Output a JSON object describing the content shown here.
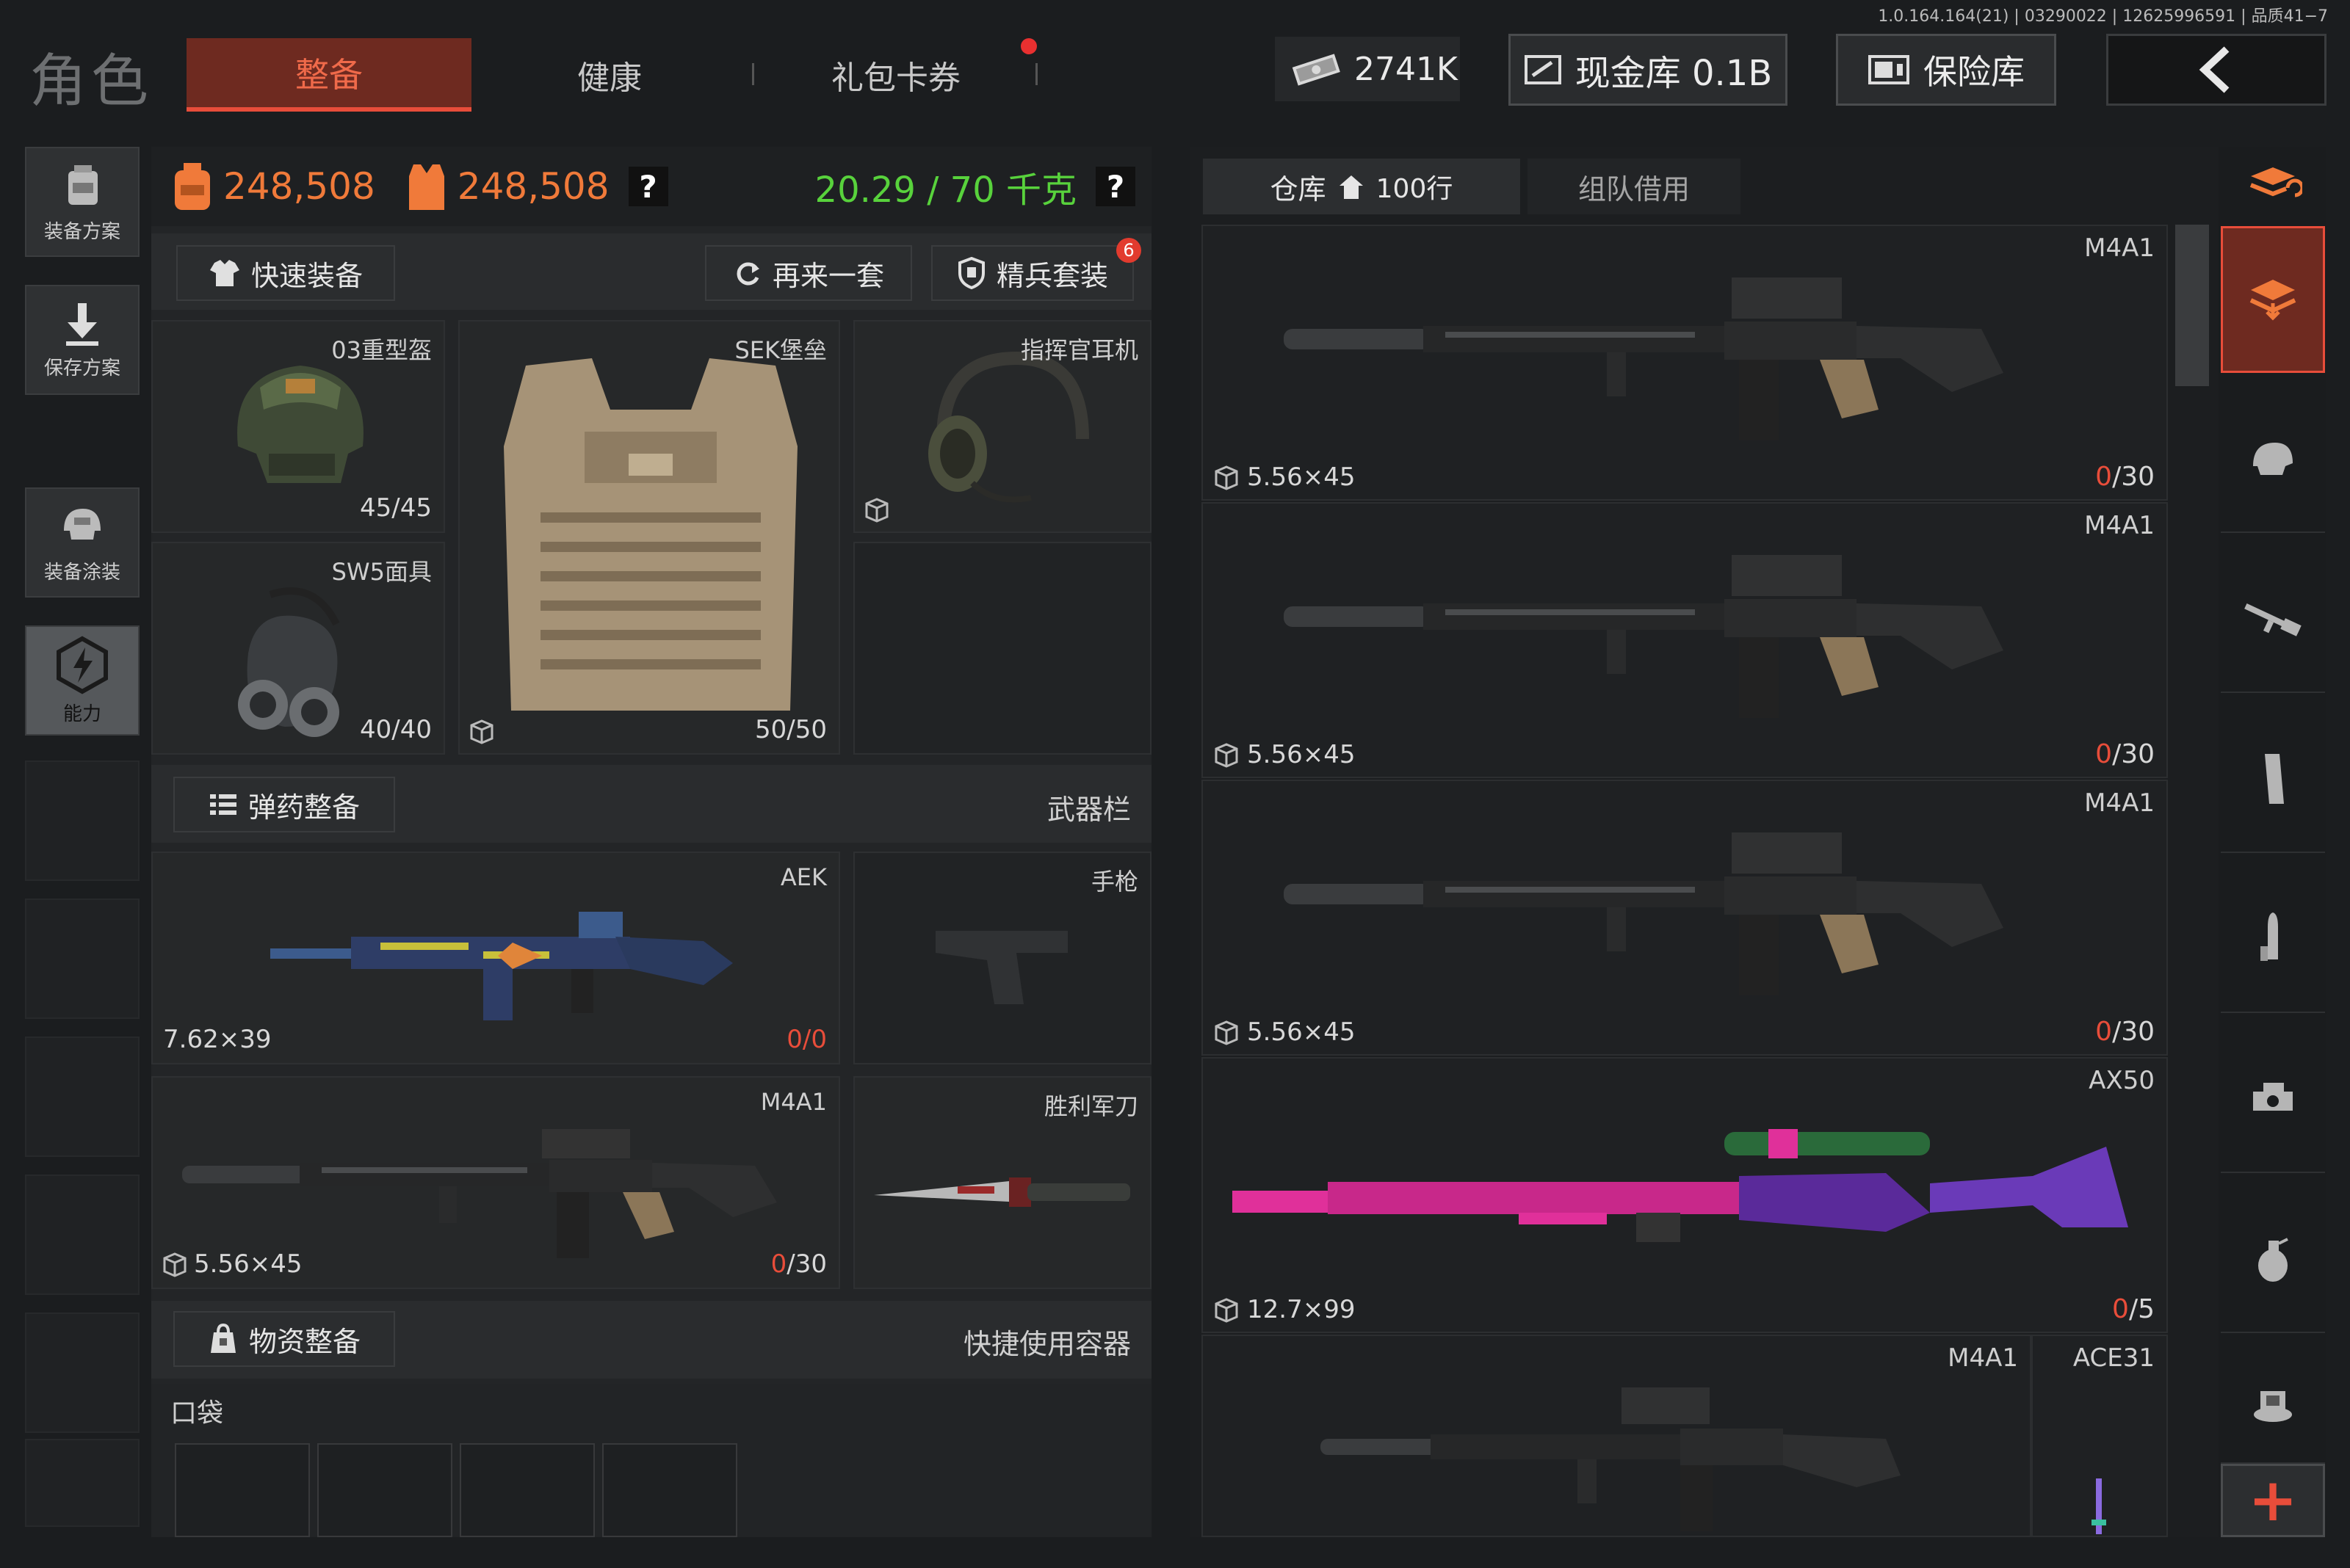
{
  "version_info": "1.0.164.164(21) | 03290022 | 12625996591 | 品质41−7",
  "colors": {
    "accent": "#e84d3a",
    "tab_active_bg": "#6e2a20",
    "green_weight": "#58d23c",
    "bg": "#1b1d1f"
  },
  "header": {
    "title": "角色",
    "tabs": [
      {
        "label": "整备",
        "active": true
      },
      {
        "label": "健康",
        "active": false
      },
      {
        "label": "礼包卡券",
        "active": false,
        "badge_dot": true
      }
    ],
    "currency": {
      "icon": "cash-icon",
      "value": "2741K"
    },
    "cash_vault": {
      "icon": "wallet-icon",
      "label": "现金库 0.1B"
    },
    "safe_vault": {
      "icon": "safe-icon",
      "label": "保险库"
    },
    "back": {
      "icon": "back-arrow-icon"
    }
  },
  "sidebar": [
    {
      "label": "装备方案",
      "icon": "backpack-plan-icon"
    },
    {
      "label": "保存方案",
      "icon": "save-download-icon"
    },
    {
      "label": "装备涂装",
      "icon": "helmet-paint-icon"
    },
    {
      "label": "能力",
      "icon": "ability-bolt-icon"
    }
  ],
  "stats": {
    "value1": "248,508",
    "value2": "248,508",
    "help1": "?",
    "weight": "20.29 / 70 千克",
    "help2": "?"
  },
  "quick_bar": {
    "quick_equip": "快速装备",
    "again": "再来一套",
    "elite": "精兵套装",
    "elite_badge": "6"
  },
  "gear": {
    "helmet": {
      "name": "03重型盔",
      "durability": "45/45"
    },
    "armor": {
      "name": "SEK堡垒",
      "durability": "50/50"
    },
    "headset": {
      "name": "指挥官耳机"
    },
    "mask": {
      "name": "SW5面具",
      "durability": "40/40"
    }
  },
  "ammo_section": {
    "button": "弹药整备",
    "label": "武器栏"
  },
  "weapons": {
    "primary1": {
      "name": "AEK",
      "caliber": "7.62×39",
      "ammo_cur": "0",
      "ammo_max": "/0"
    },
    "pistol": {
      "name": "手枪"
    },
    "primary2": {
      "name": "M4A1",
      "caliber": "5.56×45",
      "ammo_cur": "0",
      "ammo_max": "/30"
    },
    "knife": {
      "name": "胜利军刀"
    }
  },
  "supply_section": {
    "button": "物资整备",
    "label": "快捷使用容器"
  },
  "pocket": {
    "label": "口袋"
  },
  "warehouse": {
    "tab_warehouse": "仓库",
    "tab_rows": "100行",
    "tab_team": "组队借用",
    "items": [
      {
        "name": "M4A1",
        "caliber": "5.56×45",
        "cur": "0",
        "max": "/30"
      },
      {
        "name": "M4A1",
        "caliber": "5.56×45",
        "cur": "0",
        "max": "/30"
      },
      {
        "name": "M4A1",
        "caliber": "5.56×45",
        "cur": "0",
        "max": "/30"
      },
      {
        "name": "AX50",
        "caliber": "12.7×99",
        "cur": "0",
        "max": "/5"
      }
    ],
    "last_row": {
      "name_left": "M4A1",
      "name_right": "ACE31"
    }
  },
  "categories": [
    "sort-stack-icon",
    "all-items-icon",
    "helmet-icon",
    "rifle-icon",
    "magazine-icon",
    "ammo-icon",
    "scope-icon",
    "grenade-icon",
    "consumable-icon"
  ],
  "add_button": "+"
}
